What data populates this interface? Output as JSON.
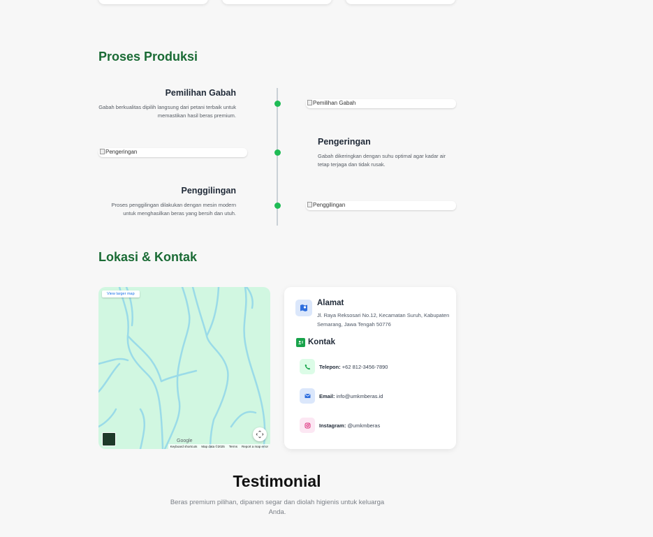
{
  "proses": {
    "title": "Proses Produksi",
    "steps": [
      {
        "title": "Pemilihan Gabah",
        "desc": "Gabah berkualitas dipilih langsung dari petani terbaik untuk memastikan hasil beras premium.",
        "img_alt": "Pemilihan Gabah"
      },
      {
        "title": "Pengeringan",
        "desc": "Gabah dikeringkan dengan suhu optimal agar kadar air tetap terjaga dan tidak rusak.",
        "img_alt": "Pengeringan"
      },
      {
        "title": "Penggilingan",
        "desc": "Proses penggilingan dilakukan dengan mesin modern untuk menghasilkan beras yang bersih dan utuh.",
        "img_alt": "Penggilingan"
      }
    ]
  },
  "lokasi": {
    "title": "Lokasi & Kontak",
    "map": {
      "larger_map": "View larger map",
      "logo": "Google",
      "footer": [
        "Keyboard shortcuts",
        "Map data ©2025",
        "Terms",
        "Report a map error"
      ]
    },
    "alamat": {
      "title": "Alamat",
      "text": "Jl. Raya Reksosari No.12, Kecamatan Suruh, Kabupaten Semarang, Jawa Tengah 50776"
    },
    "kontak": {
      "title": "Kontak",
      "telepon_label": "Telepon:",
      "telepon": "+62 812-3456-7890",
      "email_label": "Email:",
      "email": "info@umkmberas.id",
      "instagram_label": "Instagram:",
      "instagram": "@umkmberas"
    }
  },
  "testimonial": {
    "title": "Testimonial",
    "subtitle": "Beras premium pilihan, dipanen segar dan diolah higienis untuk keluarga Anda."
  },
  "colors": {
    "accent_green": "#1a6b35",
    "dot_green": "#1fbb55",
    "map_bg": "#d1f7e1",
    "river": "#9adbe8"
  },
  "icons": [
    "map-location-icon",
    "contact-card-icon",
    "phone-icon",
    "email-icon",
    "instagram-icon",
    "pan-control-icon"
  ]
}
